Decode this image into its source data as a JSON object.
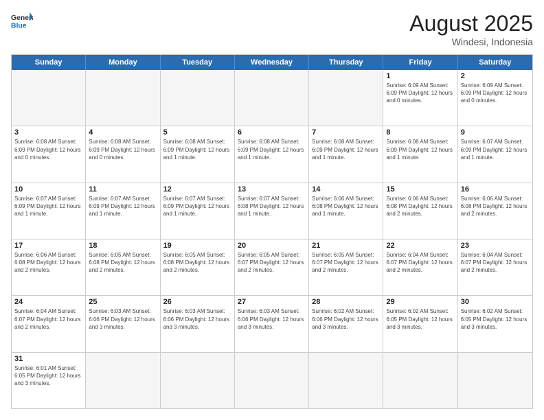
{
  "header": {
    "logo_general": "General",
    "logo_blue": "Blue",
    "title": "August 2025",
    "subtitle": "Windesi, Indonesia"
  },
  "days_of_week": [
    "Sunday",
    "Monday",
    "Tuesday",
    "Wednesday",
    "Thursday",
    "Friday",
    "Saturday"
  ],
  "weeks": [
    [
      {
        "day": "",
        "info": ""
      },
      {
        "day": "",
        "info": ""
      },
      {
        "day": "",
        "info": ""
      },
      {
        "day": "",
        "info": ""
      },
      {
        "day": "",
        "info": ""
      },
      {
        "day": "1",
        "info": "Sunrise: 6:09 AM\nSunset: 6:09 PM\nDaylight: 12 hours\nand 0 minutes."
      },
      {
        "day": "2",
        "info": "Sunrise: 6:09 AM\nSunset: 6:09 PM\nDaylight: 12 hours\nand 0 minutes."
      }
    ],
    [
      {
        "day": "3",
        "info": "Sunrise: 6:08 AM\nSunset: 6:09 PM\nDaylight: 12 hours\nand 0 minutes."
      },
      {
        "day": "4",
        "info": "Sunrise: 6:08 AM\nSunset: 6:09 PM\nDaylight: 12 hours\nand 0 minutes."
      },
      {
        "day": "5",
        "info": "Sunrise: 6:08 AM\nSunset: 6:09 PM\nDaylight: 12 hours\nand 1 minute."
      },
      {
        "day": "6",
        "info": "Sunrise: 6:08 AM\nSunset: 6:09 PM\nDaylight: 12 hours\nand 1 minute."
      },
      {
        "day": "7",
        "info": "Sunrise: 6:08 AM\nSunset: 6:09 PM\nDaylight: 12 hours\nand 1 minute."
      },
      {
        "day": "8",
        "info": "Sunrise: 6:08 AM\nSunset: 6:09 PM\nDaylight: 12 hours\nand 1 minute."
      },
      {
        "day": "9",
        "info": "Sunrise: 6:07 AM\nSunset: 6:09 PM\nDaylight: 12 hours\nand 1 minute."
      }
    ],
    [
      {
        "day": "10",
        "info": "Sunrise: 6:07 AM\nSunset: 6:09 PM\nDaylight: 12 hours\nand 1 minute."
      },
      {
        "day": "11",
        "info": "Sunrise: 6:07 AM\nSunset: 6:09 PM\nDaylight: 12 hours\nand 1 minute."
      },
      {
        "day": "12",
        "info": "Sunrise: 6:07 AM\nSunset: 6:09 PM\nDaylight: 12 hours\nand 1 minute."
      },
      {
        "day": "13",
        "info": "Sunrise: 6:07 AM\nSunset: 6:08 PM\nDaylight: 12 hours\nand 1 minute."
      },
      {
        "day": "14",
        "info": "Sunrise: 6:06 AM\nSunset: 6:08 PM\nDaylight: 12 hours\nand 1 minute."
      },
      {
        "day": "15",
        "info": "Sunrise: 6:06 AM\nSunset: 6:08 PM\nDaylight: 12 hours\nand 2 minutes."
      },
      {
        "day": "16",
        "info": "Sunrise: 6:06 AM\nSunset: 6:08 PM\nDaylight: 12 hours\nand 2 minutes."
      }
    ],
    [
      {
        "day": "17",
        "info": "Sunrise: 6:06 AM\nSunset: 6:08 PM\nDaylight: 12 hours\nand 2 minutes."
      },
      {
        "day": "18",
        "info": "Sunrise: 6:05 AM\nSunset: 6:08 PM\nDaylight: 12 hours\nand 2 minutes."
      },
      {
        "day": "19",
        "info": "Sunrise: 6:05 AM\nSunset: 6:08 PM\nDaylight: 12 hours\nand 2 minutes."
      },
      {
        "day": "20",
        "info": "Sunrise: 6:05 AM\nSunset: 6:07 PM\nDaylight: 12 hours\nand 2 minutes."
      },
      {
        "day": "21",
        "info": "Sunrise: 6:05 AM\nSunset: 6:07 PM\nDaylight: 12 hours\nand 2 minutes."
      },
      {
        "day": "22",
        "info": "Sunrise: 6:04 AM\nSunset: 6:07 PM\nDaylight: 12 hours\nand 2 minutes."
      },
      {
        "day": "23",
        "info": "Sunrise: 6:04 AM\nSunset: 6:07 PM\nDaylight: 12 hours\nand 2 minutes."
      }
    ],
    [
      {
        "day": "24",
        "info": "Sunrise: 6:04 AM\nSunset: 6:07 PM\nDaylight: 12 hours\nand 2 minutes."
      },
      {
        "day": "25",
        "info": "Sunrise: 6:03 AM\nSunset: 6:06 PM\nDaylight: 12 hours\nand 3 minutes."
      },
      {
        "day": "26",
        "info": "Sunrise: 6:03 AM\nSunset: 6:06 PM\nDaylight: 12 hours\nand 3 minutes."
      },
      {
        "day": "27",
        "info": "Sunrise: 6:03 AM\nSunset: 6:06 PM\nDaylight: 12 hours\nand 3 minutes."
      },
      {
        "day": "28",
        "info": "Sunrise: 6:02 AM\nSunset: 6:06 PM\nDaylight: 12 hours\nand 3 minutes."
      },
      {
        "day": "29",
        "info": "Sunrise: 6:02 AM\nSunset: 6:05 PM\nDaylight: 12 hours\nand 3 minutes."
      },
      {
        "day": "30",
        "info": "Sunrise: 6:02 AM\nSunset: 6:05 PM\nDaylight: 12 hours\nand 3 minutes."
      }
    ],
    [
      {
        "day": "31",
        "info": "Sunrise: 6:01 AM\nSunset: 6:05 PM\nDaylight: 12 hours\nand 3 minutes."
      },
      {
        "day": "",
        "info": ""
      },
      {
        "day": "",
        "info": ""
      },
      {
        "day": "",
        "info": ""
      },
      {
        "day": "",
        "info": ""
      },
      {
        "day": "",
        "info": ""
      },
      {
        "day": "",
        "info": ""
      }
    ]
  ]
}
